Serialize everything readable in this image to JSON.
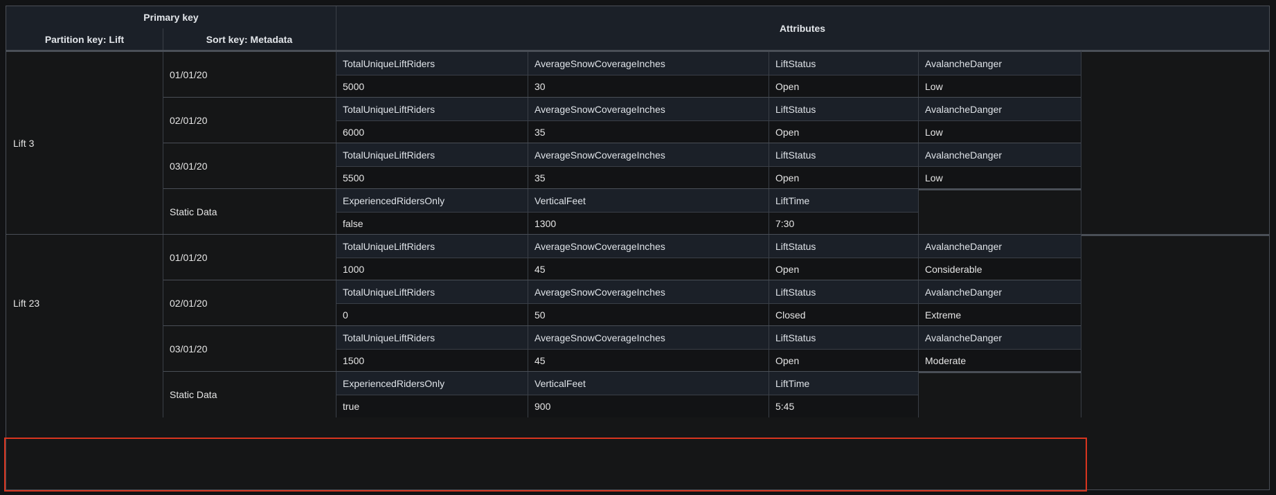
{
  "header": {
    "primary_key": "Primary key",
    "partition_key": "Partition key: Lift",
    "sort_key": "Sort key: Metadata",
    "attributes": "Attributes"
  },
  "lifts": [
    {
      "name": "Lift 3",
      "rows": [
        {
          "sort": "01/01/20",
          "names": [
            "TotalUniqueLiftRiders",
            "AverageSnowCoverageInches",
            "LiftStatus",
            "AvalancheDanger"
          ],
          "values": [
            "5000",
            "30",
            "Open",
            "Low"
          ]
        },
        {
          "sort": "02/01/20",
          "names": [
            "TotalUniqueLiftRiders",
            "AverageSnowCoverageInches",
            "LiftStatus",
            "AvalancheDanger"
          ],
          "values": [
            "6000",
            "35",
            "Open",
            "Low"
          ]
        },
        {
          "sort": "03/01/20",
          "names": [
            "TotalUniqueLiftRiders",
            "AverageSnowCoverageInches",
            "LiftStatus",
            "AvalancheDanger"
          ],
          "values": [
            "5500",
            "35",
            "Open",
            "Low"
          ]
        },
        {
          "sort": "Static Data",
          "names": [
            "ExperiencedRidersOnly",
            "VerticalFeet",
            "LiftTime"
          ],
          "values": [
            "false",
            "1300",
            "7:30"
          ]
        }
      ]
    },
    {
      "name": "Lift 23",
      "rows": [
        {
          "sort": "01/01/20",
          "names": [
            "TotalUniqueLiftRiders",
            "AverageSnowCoverageInches",
            "LiftStatus",
            "AvalancheDanger"
          ],
          "values": [
            "1000",
            "45",
            "Open",
            "Considerable"
          ]
        },
        {
          "sort": "02/01/20",
          "names": [
            "TotalUniqueLiftRiders",
            "AverageSnowCoverageInches",
            "LiftStatus",
            "AvalancheDanger"
          ],
          "values": [
            "0",
            "50",
            "Closed",
            "Extreme"
          ]
        },
        {
          "sort": "03/01/20",
          "names": [
            "TotalUniqueLiftRiders",
            "AverageSnowCoverageInches",
            "LiftStatus",
            "AvalancheDanger"
          ],
          "values": [
            "1500",
            "45",
            "Open",
            "Moderate"
          ]
        },
        {
          "sort": "Static Data",
          "names": [
            "ExperiencedRidersOnly",
            "VerticalFeet",
            "LiftTime"
          ],
          "values": [
            "true",
            "900",
            "5:45"
          ]
        }
      ]
    }
  ],
  "colors": {
    "background": "#121315",
    "header_bg": "#1b2028",
    "highlight_border": "#d9351f"
  }
}
